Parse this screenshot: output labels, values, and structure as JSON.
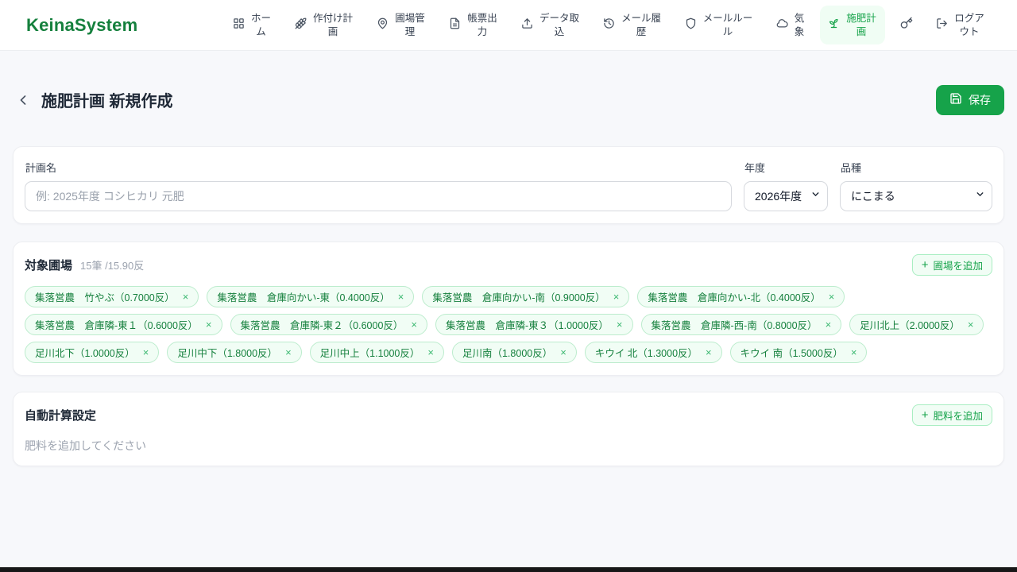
{
  "app": {
    "name": "KeinaSystem"
  },
  "nav": {
    "items": [
      {
        "label": "ホーム",
        "icon": "grid-icon"
      },
      {
        "label": "作付け計画",
        "icon": "wheat-icon"
      },
      {
        "label": "圃場管理",
        "icon": "map-pin-icon"
      },
      {
        "label": "帳票出力",
        "icon": "report-icon"
      },
      {
        "label": "データ取込",
        "icon": "upload-icon"
      },
      {
        "label": "メール履歴",
        "icon": "history-icon"
      },
      {
        "label": "メールルール",
        "icon": "shield-icon"
      },
      {
        "label": "気象",
        "icon": "cloud-icon"
      },
      {
        "label": "施肥計画",
        "icon": "sprout-icon",
        "active": true
      },
      {
        "label": "",
        "icon": "key-icon"
      },
      {
        "label": "ログアウト",
        "icon": "logout-icon"
      }
    ]
  },
  "header": {
    "title": "施肥計画 新規作成",
    "back_icon": "chevron-left-icon",
    "save_label": "保存",
    "save_icon": "floppy-icon"
  },
  "form": {
    "plan_name": {
      "label": "計画名",
      "placeholder": "例: 2025年度 コシヒカリ 元肥",
      "value": ""
    },
    "year": {
      "label": "年度",
      "value": "2026年度"
    },
    "variety": {
      "label": "品種",
      "value": "にこまる"
    }
  },
  "fields": {
    "title": "対象圃場",
    "summary": "15筆 /15.90反",
    "plus_glyph": "+",
    "add_label": "圃場を追加",
    "close_glyph": "×",
    "chips": [
      "集落営農　竹やぶ（0.7000反）",
      "集落営農　倉庫向かい-東（0.4000反）",
      "集落営農　倉庫向かい-南（0.9000反）",
      "集落営農　倉庫向かい-北（0.4000反）",
      "集落営農　倉庫隣-東１（0.6000反）",
      "集落営農　倉庫隣-東２（0.6000反）",
      "集落営農　倉庫隣-東３（1.0000反）",
      "集落営農　倉庫隣-西-南（0.8000反）",
      "足川北上（2.0000反）",
      "足川北下（1.0000反）",
      "足川中下（1.8000反）",
      "足川中上（1.1000反）",
      "足川南（1.8000反）",
      "キウイ 北（1.3000反）",
      "キウイ 南（1.5000反）"
    ]
  },
  "auto_calc": {
    "title": "自動計算設定",
    "plus_glyph": "+",
    "add_label": "肥料を追加",
    "empty_text": "肥料を追加してください"
  },
  "colors": {
    "primary_green": "#16a34a",
    "logo_green": "#15803d",
    "active_nav_bg": "#f0fdf4",
    "chip_bg": "#f1fdf5",
    "chip_border": "#bceccd",
    "chip_text": "#15803d",
    "page_bg": "#f7f8fb",
    "muted_text": "#9ca3af"
  }
}
